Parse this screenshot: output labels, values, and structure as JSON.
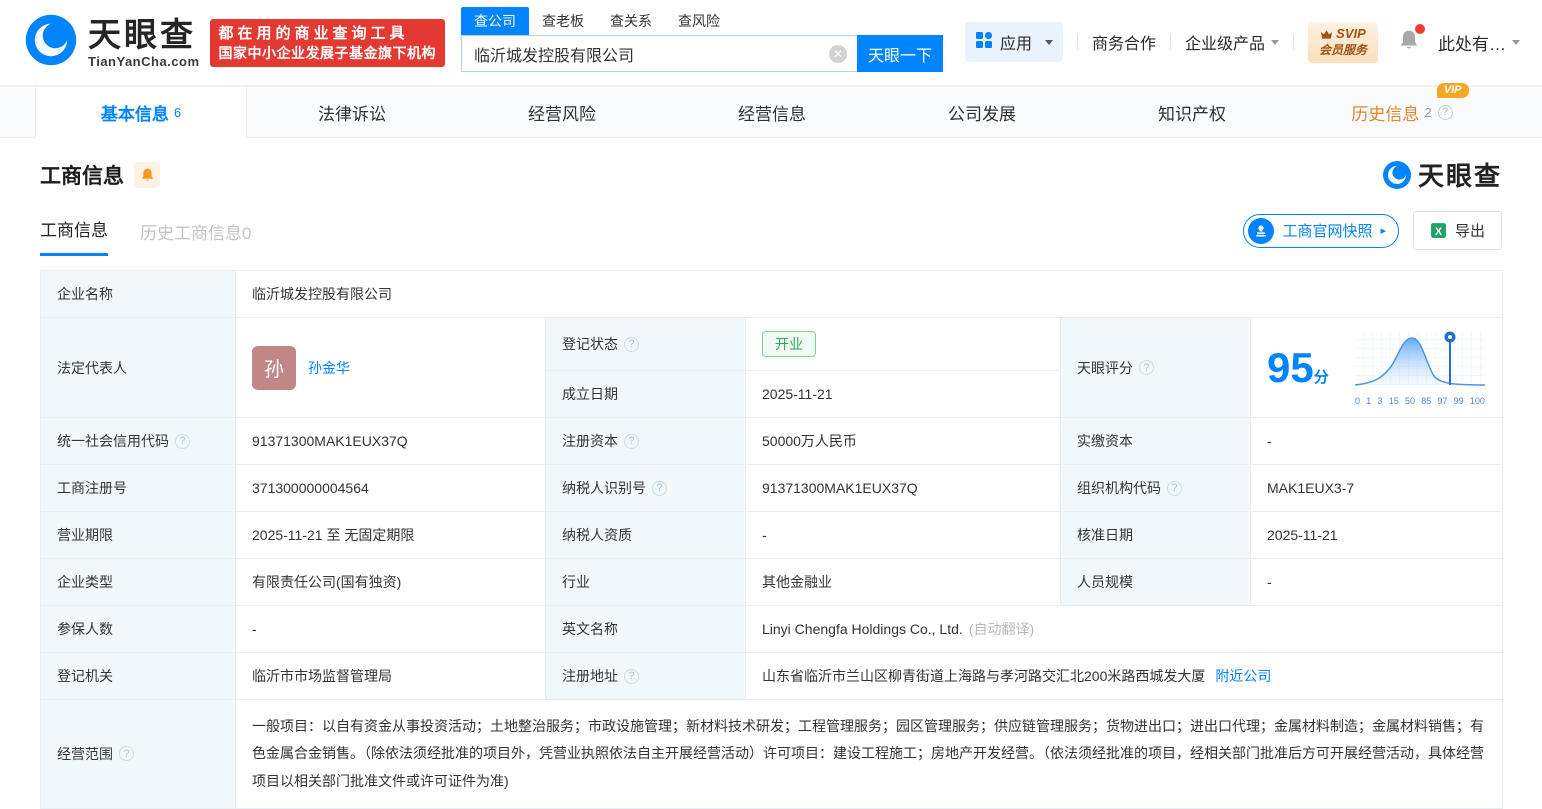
{
  "colors": {
    "primary": "#0084ff",
    "red": "#e23a33",
    "green": "#2fa75c",
    "orange": "#e0862e"
  },
  "header": {
    "brand": "天眼查",
    "brand_domain": "TianYanCha.com",
    "slogan_line1": "都在用的商业查询工具",
    "slogan_line2": "国家中小企业发展子基金旗下机构",
    "search": {
      "tabs": [
        {
          "label": "查公司"
        },
        {
          "label": "查老板"
        },
        {
          "label": "查关系"
        },
        {
          "label": "查风险"
        }
      ],
      "value": "临沂城发控股有限公司",
      "button_label": "天眼一下"
    },
    "nav": {
      "apps_label": "应用",
      "biz_coop": "商务合作",
      "enterprise": "企业级产品",
      "svip_line1": "SVIP",
      "svip_line2": "会员服务",
      "user_label": "此处有…"
    }
  },
  "tabs": {
    "basic": {
      "label": "基本信息",
      "count": "6"
    },
    "legal": {
      "label": "法律诉讼"
    },
    "risk": {
      "label": "经营风险"
    },
    "operation": {
      "label": "经营信息"
    },
    "development": {
      "label": "公司发展"
    },
    "ip": {
      "label": "知识产权"
    },
    "history": {
      "label": "历史信息",
      "count": "2",
      "vip": "VIP"
    }
  },
  "section": {
    "title": "工商信息",
    "watermark": "天眼查",
    "subtab_active": "工商信息",
    "subtab_inactive": "历史工商信息0",
    "snapshot_button": "工商官网快照",
    "snapshot_arrow": "▸",
    "export_button": "导出"
  },
  "fields": {
    "company_name": {
      "label": "企业名称",
      "value": "临沂城发控股有限公司"
    },
    "legal_rep": {
      "label": "法定代表人",
      "avatar": "孙",
      "name": "孙金华"
    },
    "reg_status": {
      "label": "登记状态",
      "value": "开业",
      "help": true
    },
    "establish_date": {
      "label": "成立日期",
      "value": "2025-11-21"
    },
    "score": {
      "label": "天眼评分",
      "help": true
    },
    "credit_code": {
      "label": "统一社会信用代码",
      "value": "91371300MAK1EUX37Q",
      "help": true
    },
    "reg_capital": {
      "label": "注册资本",
      "value": "50000万人民币",
      "help": true
    },
    "paid_capital": {
      "label": "实缴资本",
      "value": "-"
    },
    "reg_number": {
      "label": "工商注册号",
      "value": "371300000004564"
    },
    "taxpayer_id": {
      "label": "纳税人识别号",
      "value": "91371300MAK1EUX37Q",
      "help": true
    },
    "org_code": {
      "label": "组织机构代码",
      "value": "MAK1EUX3-7",
      "help": true
    },
    "business_term": {
      "label": "营业期限",
      "value": "2025-11-21 至 无固定期限"
    },
    "taxpayer_quality": {
      "label": "纳税人资质",
      "value": "-"
    },
    "approval_date": {
      "label": "核准日期",
      "value": "2025-11-21"
    },
    "company_type": {
      "label": "企业类型",
      "value": "有限责任公司(国有独资)"
    },
    "industry": {
      "label": "行业",
      "value": "其他金融业"
    },
    "staff_size": {
      "label": "人员规模",
      "value": "-"
    },
    "insured_count": {
      "label": "参保人数",
      "value": "-"
    },
    "english_name": {
      "label": "英文名称",
      "value": "Linyi Chengfa Holdings Co., Ltd.",
      "note": "(自动翻译)"
    },
    "reg_authority": {
      "label": "登记机关",
      "value": "临沂市市场监督管理局"
    },
    "reg_address": {
      "label": "注册地址",
      "value": "山东省临沂市兰山区柳青街道上海路与孝河路交汇北200米路西城发大厦",
      "link": "附近公司",
      "help": true
    },
    "business_scope": {
      "label": "经营范围",
      "help": true,
      "value": "一般项目：以自有资金从事投资活动；土地整治服务；市政设施管理；新材料技术研发；工程管理服务；园区管理服务；供应链管理服务；货物进出口；进出口代理；金属材料制造；金属材料销售；有色金属合金销售。（除依法须经批准的项目外，凭营业执照依法自主开展经营活动）许可项目：建设工程施工；房地产开发经营。（依法须经批准的项目，经相关部门批准后方可开展经营活动，具体经营项目以相关部门批准文件或许可证件为准)"
    }
  },
  "score_chart": {
    "type": "area",
    "title": "天眼评分分布曲线",
    "score": "95",
    "unit": "分",
    "marker_value": 95,
    "ticks": [
      "0",
      "1",
      "3",
      "15",
      "50",
      "85",
      "97",
      "99",
      "100"
    ],
    "xlim": [
      0,
      100
    ],
    "grid": true
  }
}
